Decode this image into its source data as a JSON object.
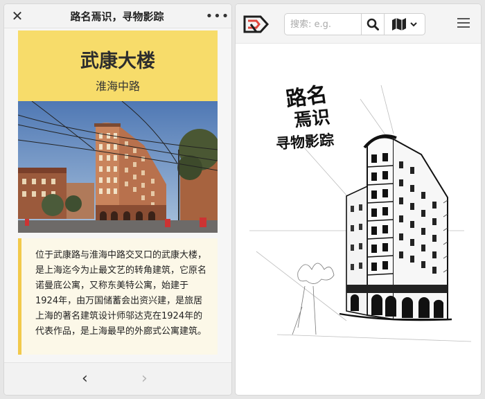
{
  "left_panel": {
    "title": "路名焉识，寻物影踪",
    "close_glyph": "✕",
    "more_glyph": "•••",
    "building_name": "武康大楼",
    "road_name": "淮海中路",
    "description": "位于武康路与淮海中路交叉口的武康大楼，是上海迄今为止最文艺的转角建筑，它原名诺曼底公寓，又称东美特公寓，始建于1924年，由万国储蓄会出资兴建，是旅居上海的著名建筑设计师邬达克在1924年的代表作品，是上海最早的外廊式公寓建筑。",
    "nav_back_glyph": "‹",
    "nav_forward_glyph": "›"
  },
  "right_panel": {
    "search_placeholder": "搜索: e.g.",
    "calligraphy": {
      "line1": "路名",
      "line2": "焉识",
      "line3": "寻物影踪"
    }
  },
  "colors": {
    "header_yellow": "#f7dc6a",
    "quote_border": "#f2c94c",
    "quote_bg": "#fcf8e8",
    "logo_red": "#e0463c"
  },
  "icons": [
    "close-icon",
    "more-icon",
    "chevron-left-icon",
    "chevron-right-icon",
    "logo-icon",
    "search-icon",
    "map-icon",
    "chevron-down-icon",
    "hamburger-menu-icon"
  ]
}
